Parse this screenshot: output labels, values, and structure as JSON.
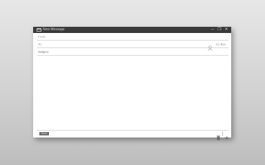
{
  "window": {
    "title": "New Message",
    "controls": {
      "minimize": "–",
      "maximize": "❐",
      "close": "✕"
    }
  },
  "compose": {
    "from_label": "From:",
    "to_label": "To:",
    "subject_placeholder": "Subject",
    "cc_bcc_label": "Cc Bcc",
    "body_value": ""
  },
  "footer": {
    "send_label": "Send"
  },
  "icons": {
    "app": "mail-app-icon",
    "contacts": "contacts-icon",
    "discard": "trash-icon",
    "more": "arrow-options-icon"
  },
  "colors": {
    "titlebar": "#3a3a3a",
    "send_button": "#6e6e6e",
    "background": "#d2d2d2"
  }
}
